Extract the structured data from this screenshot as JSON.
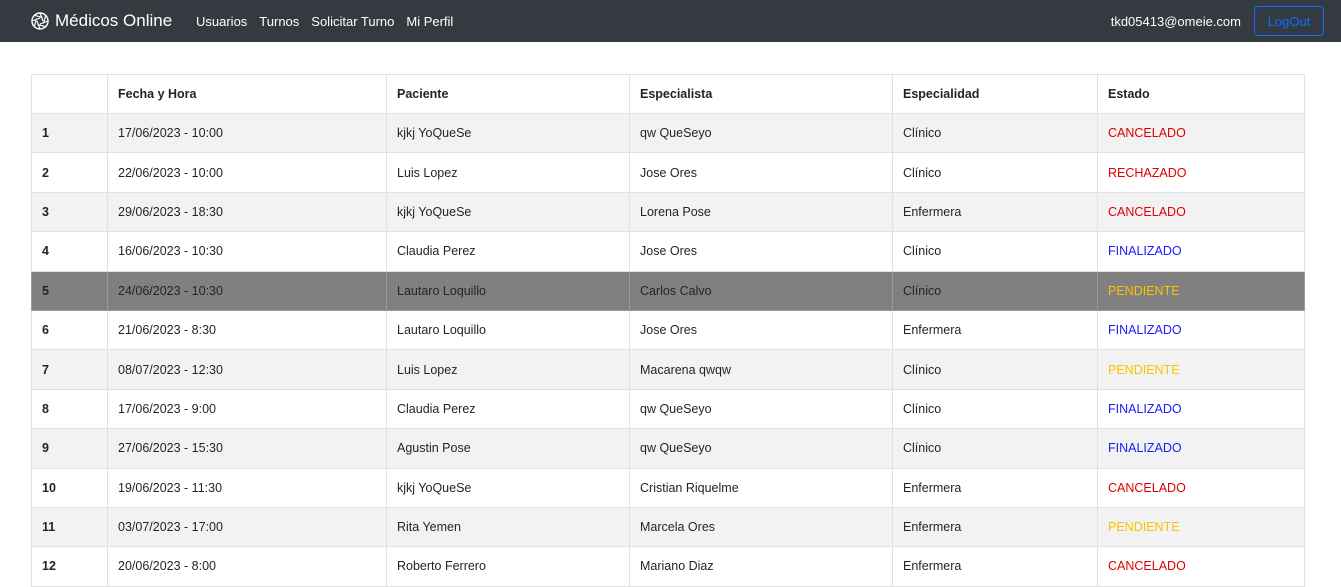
{
  "navbar": {
    "brand": "Médicos Online",
    "brand_icon": "aperture-icon",
    "links": [
      "Usuarios",
      "Turnos",
      "Solicitar Turno",
      "Mi Perfil"
    ],
    "user_email": "tkd05413@omeie.com",
    "logout_label": "LogOut"
  },
  "colors": {
    "navbar_bg": "#343a40",
    "cancelado": "#e00000",
    "rechazado": "#e00000",
    "finalizado": "#1a1aff",
    "pendiente": "#ffc000",
    "highlight_row": "#808080"
  },
  "table": {
    "headers": [
      "",
      "Fecha y Hora",
      "Paciente",
      "Especialista",
      "Especialidad",
      "Estado"
    ],
    "highlighted_row": 5,
    "rows": [
      {
        "num": "1",
        "fecha": "17/06/2023 - 10:00",
        "paciente": "kjkj YoQueSe",
        "especialista": "qw QueSeyo",
        "especialidad": "Clínico",
        "estado": "CANCELADO"
      },
      {
        "num": "2",
        "fecha": "22/06/2023 - 10:00",
        "paciente": "Luis Lopez",
        "especialista": "Jose Ores",
        "especialidad": "Clínico",
        "estado": "RECHAZADO"
      },
      {
        "num": "3",
        "fecha": "29/06/2023 - 18:30",
        "paciente": "kjkj YoQueSe",
        "especialista": "Lorena Pose",
        "especialidad": "Enfermera",
        "estado": "CANCELADO"
      },
      {
        "num": "4",
        "fecha": "16/06/2023 - 10:30",
        "paciente": "Claudia Perez",
        "especialista": "Jose Ores",
        "especialidad": "Clínico",
        "estado": "FINALIZADO"
      },
      {
        "num": "5",
        "fecha": "24/06/2023 - 10:30",
        "paciente": "Lautaro Loquillo",
        "especialista": "Carlos Calvo",
        "especialidad": "Clínico",
        "estado": "PENDIENTE"
      },
      {
        "num": "6",
        "fecha": "21/06/2023 - 8:30",
        "paciente": "Lautaro Loquillo",
        "especialista": "Jose Ores",
        "especialidad": "Enfermera",
        "estado": "FINALIZADO"
      },
      {
        "num": "7",
        "fecha": "08/07/2023 - 12:30",
        "paciente": "Luis Lopez",
        "especialista": "Macarena qwqw",
        "especialidad": "Clínico",
        "estado": "PENDIENTE"
      },
      {
        "num": "8",
        "fecha": "17/06/2023 - 9:00",
        "paciente": "Claudia Perez",
        "especialista": "qw QueSeyo",
        "especialidad": "Clínico",
        "estado": "FINALIZADO"
      },
      {
        "num": "9",
        "fecha": "27/06/2023 - 15:30",
        "paciente": "Agustin Pose",
        "especialista": "qw QueSeyo",
        "especialidad": "Clínico",
        "estado": "FINALIZADO"
      },
      {
        "num": "10",
        "fecha": "19/06/2023 - 11:30",
        "paciente": "kjkj YoQueSe",
        "especialista": "Cristian Riquelme",
        "especialidad": "Enfermera",
        "estado": "CANCELADO"
      },
      {
        "num": "11",
        "fecha": "03/07/2023 - 17:00",
        "paciente": "Rita Yemen",
        "especialista": "Marcela Ores",
        "especialidad": "Enfermera",
        "estado": "PENDIENTE"
      },
      {
        "num": "12",
        "fecha": "20/06/2023 - 8:00",
        "paciente": "Roberto Ferrero",
        "especialista": "Mariano Diaz",
        "especialidad": "Enfermera",
        "estado": "CANCELADO"
      }
    ]
  }
}
